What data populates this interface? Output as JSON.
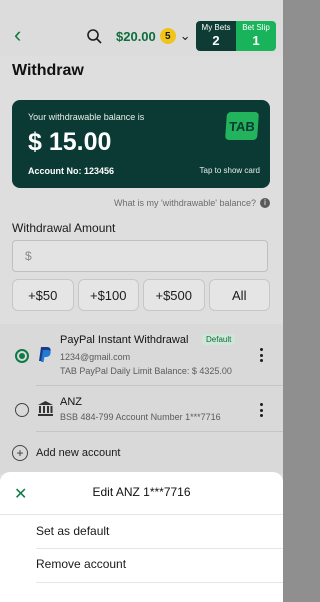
{
  "header": {
    "balance": "$20.00",
    "balance_badge": "5",
    "my_bets_label": "My Bets",
    "my_bets_count": "2",
    "bet_slip_label": "Bet Slip",
    "bet_slip_count": "1",
    "colors": {
      "brand_green": "#19b35c",
      "dark_teal": "#0e3c35"
    }
  },
  "page": {
    "title": "Withdraw"
  },
  "card": {
    "label": "Your withdrawable balance is",
    "amount": "$ 15.00",
    "account": "Account No: 123456",
    "show_card": "Tap to show card",
    "logo": "TAB"
  },
  "help_link": "What is my 'withdrawable' balance?",
  "withdrawal": {
    "label": "Withdrawal Amount",
    "placeholder": "$",
    "quick_amounts": [
      "+$50",
      "+$100",
      "+$500",
      "All"
    ]
  },
  "accounts": [
    {
      "title": "PayPal Instant Withdrawal",
      "tag": "Default",
      "line1": "1234@gmail.com",
      "line2": "TAB PayPal Daily Limit Balance: $ 4325.00",
      "selected": true
    },
    {
      "title": "ANZ",
      "line1": "BSB 484-799 Account Number 1***7716",
      "selected": false
    }
  ],
  "add_account": "Add new account",
  "sheet": {
    "title": "Edit ANZ 1***7716",
    "options": [
      "Set as default",
      "Remove account"
    ]
  }
}
